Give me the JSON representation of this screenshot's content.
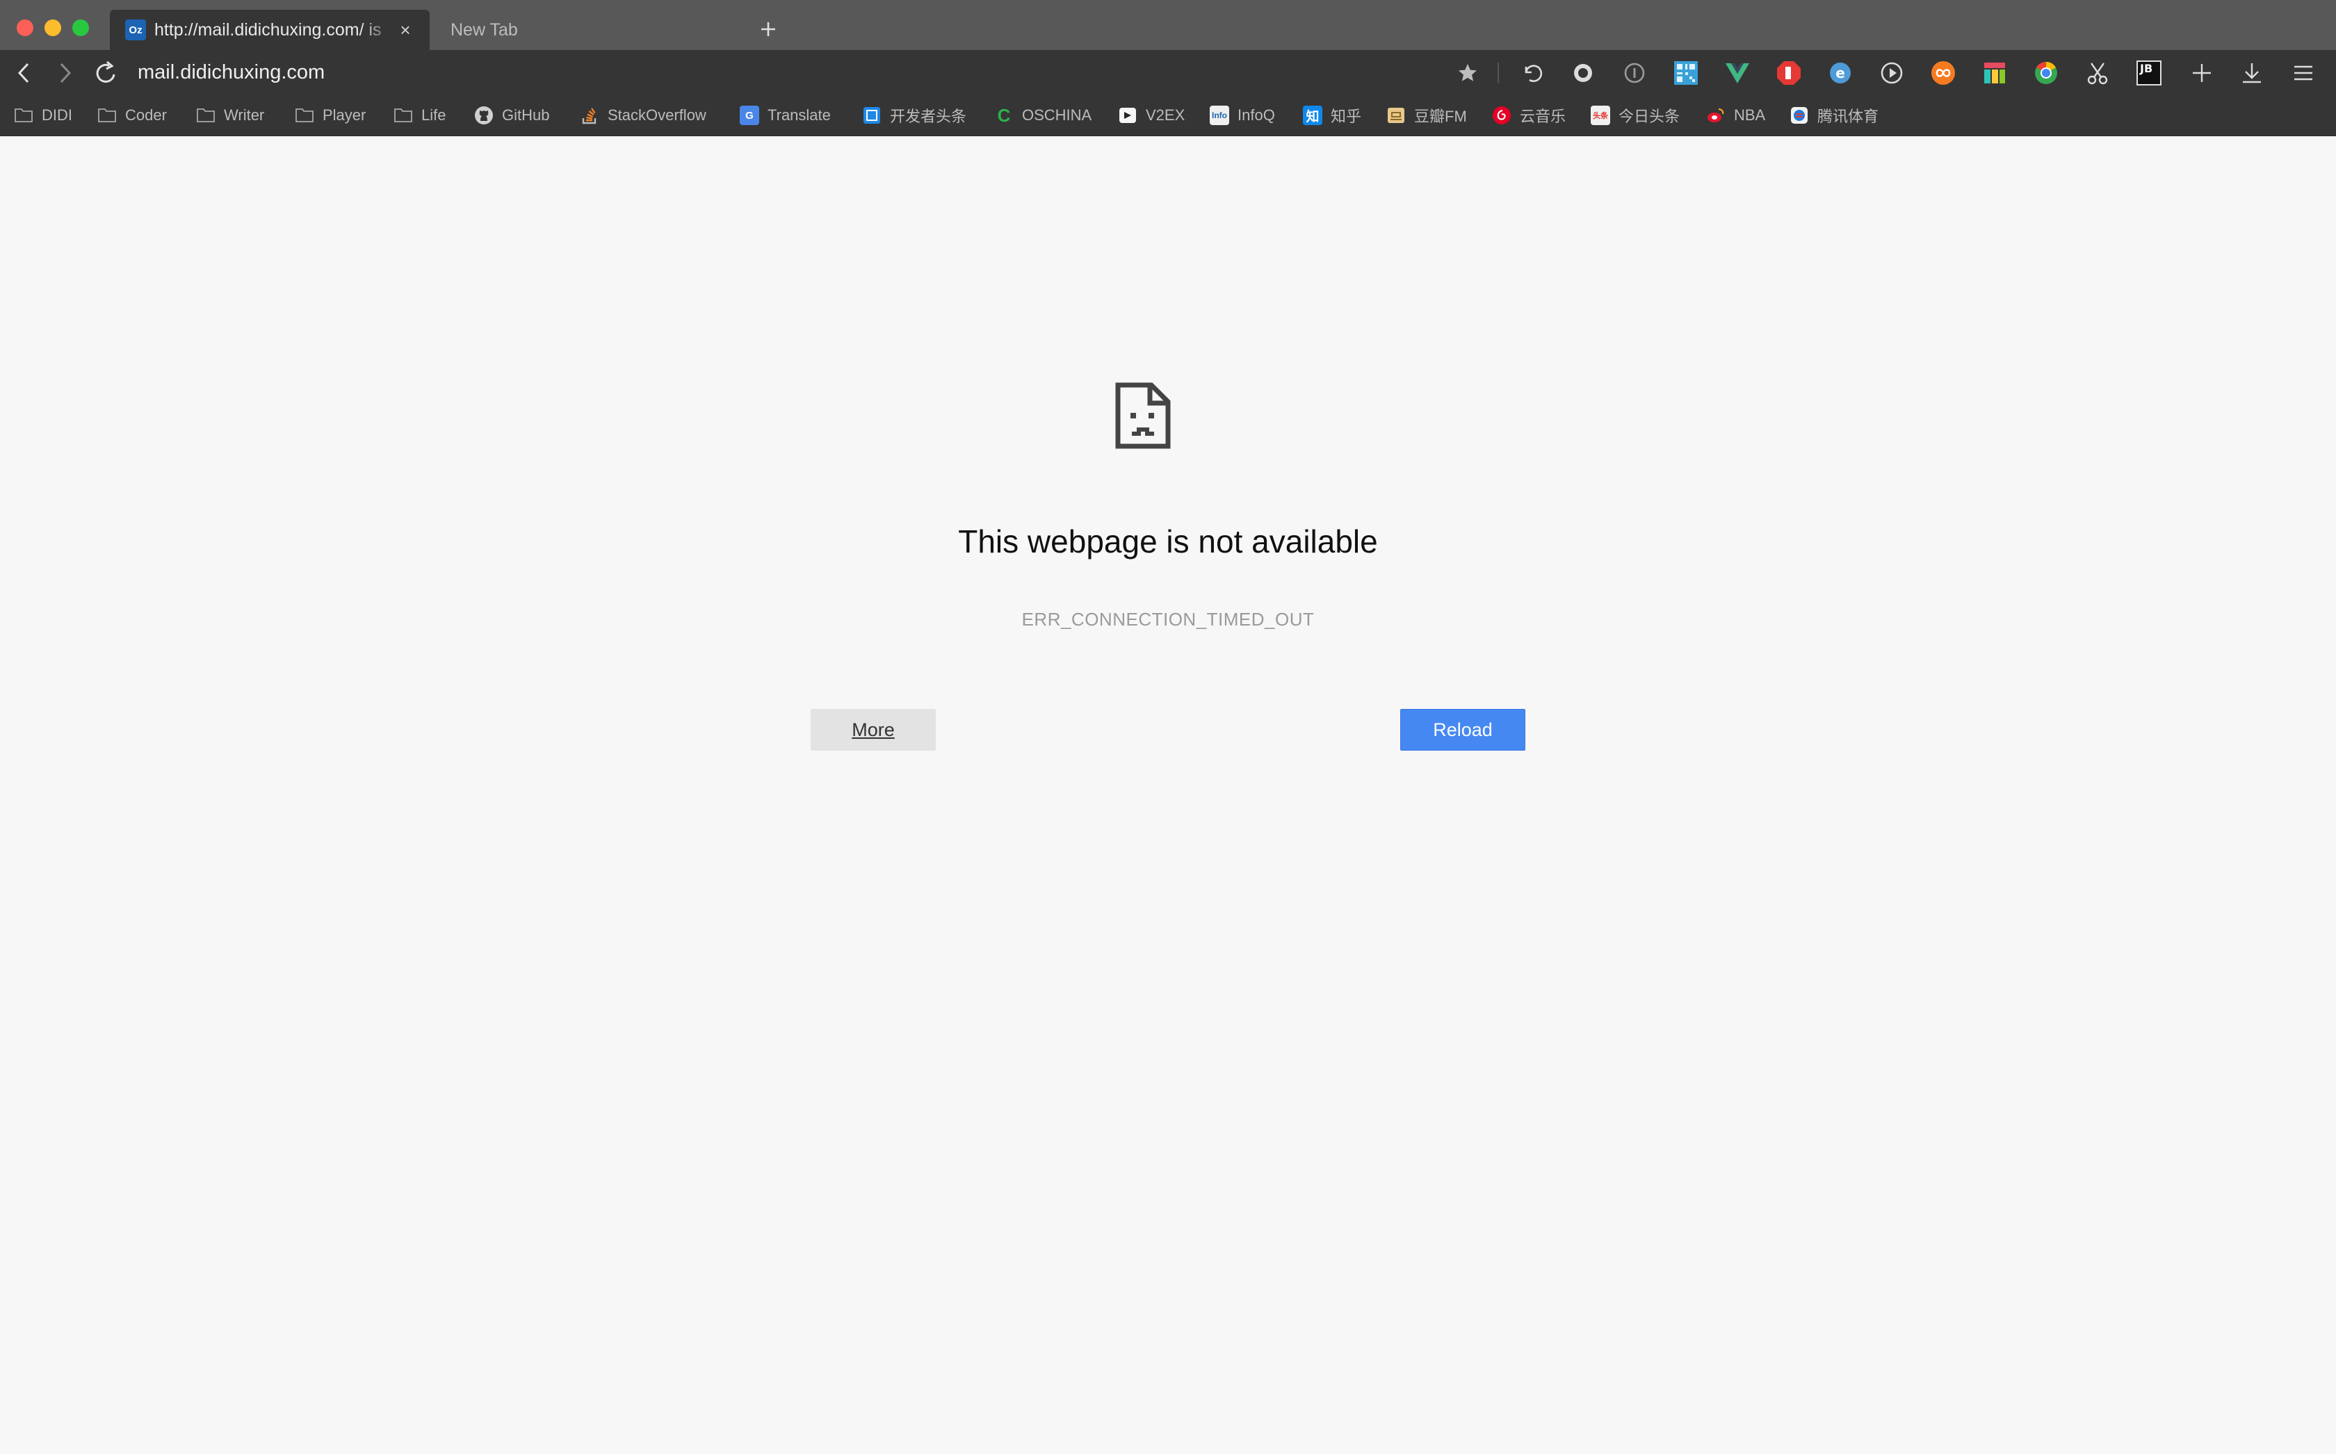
{
  "window": {
    "colors": {
      "close": "#fc5f57",
      "minimize": "#fdbc2e",
      "maximize": "#28c840"
    }
  },
  "tabs": [
    {
      "title": "http://mail.didichuxing.com/ is",
      "favicon": "outlook-icon",
      "favicon_text": "Oz",
      "active": true,
      "close_label": "×"
    },
    {
      "title": "New Tab",
      "active": false
    }
  ],
  "address_bar": {
    "url": "mail.didichuxing.com"
  },
  "extensions": [
    "bookmark-star-icon",
    "undo-icon",
    "record-icon",
    "info-icon",
    "qr-code-icon",
    "vue-devtools-icon",
    "adblock-icon",
    "ie-tab-icon",
    "play-icon",
    "infinity-icon",
    "color-palette-icon",
    "chrome-icon",
    "scissors-icon",
    "jetbrains-icon",
    "plus-icon",
    "download-icon",
    "menu-icon"
  ],
  "extension_labels": {
    "jetbrains": "JB"
  },
  "bookmarks": [
    {
      "label": "DIDI",
      "icon": "folder-icon"
    },
    {
      "label": "Coder",
      "icon": "folder-icon"
    },
    {
      "label": "Writer",
      "icon": "folder-icon"
    },
    {
      "label": "Player",
      "icon": "folder-icon"
    },
    {
      "label": "Life",
      "icon": "folder-icon"
    },
    {
      "label": "GitHub",
      "icon": "github-icon"
    },
    {
      "label": "StackOverflow",
      "icon": "stackoverflow-icon"
    },
    {
      "label": "Translate",
      "icon": "google-translate-icon",
      "icon_text": "G"
    },
    {
      "label": "开发者头条",
      "icon": "toutiao-dev-icon"
    },
    {
      "label": "OSCHINA",
      "icon": "oschina-icon",
      "icon_text": "C"
    },
    {
      "label": "V2EX",
      "icon": "v2ex-icon"
    },
    {
      "label": "InfoQ",
      "icon": "infoq-icon",
      "icon_text": "Info"
    },
    {
      "label": "知乎",
      "icon": "zhihu-icon",
      "icon_text": "知"
    },
    {
      "label": "豆瓣FM",
      "icon": "douban-fm-icon"
    },
    {
      "label": "云音乐",
      "icon": "netease-music-icon"
    },
    {
      "label": "今日头条",
      "icon": "toutiao-icon",
      "icon_text": "头条"
    },
    {
      "label": "NBA",
      "icon": "weibo-icon"
    },
    {
      "label": "腾讯体育",
      "icon": "tencent-sports-icon"
    }
  ],
  "error_page": {
    "title": "This webpage is not available",
    "code": "ERR_CONNECTION_TIMED_OUT",
    "more_label": "More",
    "reload_label": "Reload",
    "accent": "#4688f1"
  }
}
